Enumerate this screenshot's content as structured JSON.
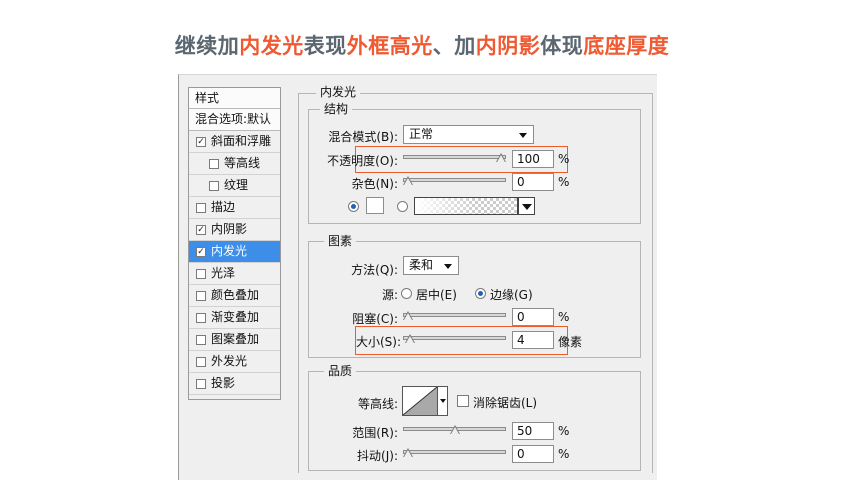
{
  "headline": {
    "p1": "继续加",
    "p2": "内发光",
    "p3": "表现",
    "p4": "外框高光",
    "p5": "、加",
    "p6": "内阴影",
    "p7": "体现",
    "p8": "底座厚度",
    "gray_color": "#5b6670",
    "red_color": "#ef5a32"
  },
  "styles_panel": {
    "header": "样式",
    "blend_options": "混合选项:默认",
    "items": [
      {
        "label": "斜面和浮雕",
        "checked": true
      },
      {
        "label": "等高线",
        "checked": false
      },
      {
        "label": "纹理",
        "checked": false
      },
      {
        "label": "描边",
        "checked": false
      },
      {
        "label": "内阴影",
        "checked": true
      },
      {
        "label": "内发光",
        "checked": true,
        "selected": true
      },
      {
        "label": "光泽",
        "checked": false
      },
      {
        "label": "颜色叠加",
        "checked": false
      },
      {
        "label": "渐变叠加",
        "checked": false
      },
      {
        "label": "图案叠加",
        "checked": false
      },
      {
        "label": "外发光",
        "checked": false
      },
      {
        "label": "投影",
        "checked": false
      }
    ],
    "check_mark": "✓",
    "selected_color": "#3d8ee9"
  },
  "inner_glow": {
    "title": "内发光",
    "structure": {
      "title": "结构",
      "blend_mode_label": "混合模式(B):",
      "blend_mode_value": "正常",
      "opacity_label": "不透明度(O):",
      "opacity_value": "100",
      "opacity_unit": "%",
      "opacity_level": 1.0,
      "noise_label": "杂色(N):",
      "noise_value": "0",
      "noise_unit": "%",
      "noise_level": 0.0
    },
    "elements": {
      "title": "图素",
      "method_label": "方法(Q):",
      "method_value": "柔和",
      "source_label": "源:",
      "source_center": "居中(E)",
      "source_edge": "边缘(G)",
      "choke_label": "阻塞(C):",
      "choke_value": "0",
      "choke_unit": "%",
      "choke_level": 0.0,
      "size_label": "大小(S):",
      "size_value": "4",
      "size_unit": "像素",
      "size_level": 0.02
    },
    "quality": {
      "title": "品质",
      "contour_label": "等高线:",
      "antialias_label": "消除锯齿(L)",
      "range_label": "范围(R):",
      "range_value": "50",
      "range_unit": "%",
      "range_level": 0.5,
      "jitter_label": "抖动(J):",
      "jitter_value": "0",
      "jitter_unit": "%",
      "jitter_level": 0.0
    },
    "highlight_color": "#ec5b2b"
  }
}
